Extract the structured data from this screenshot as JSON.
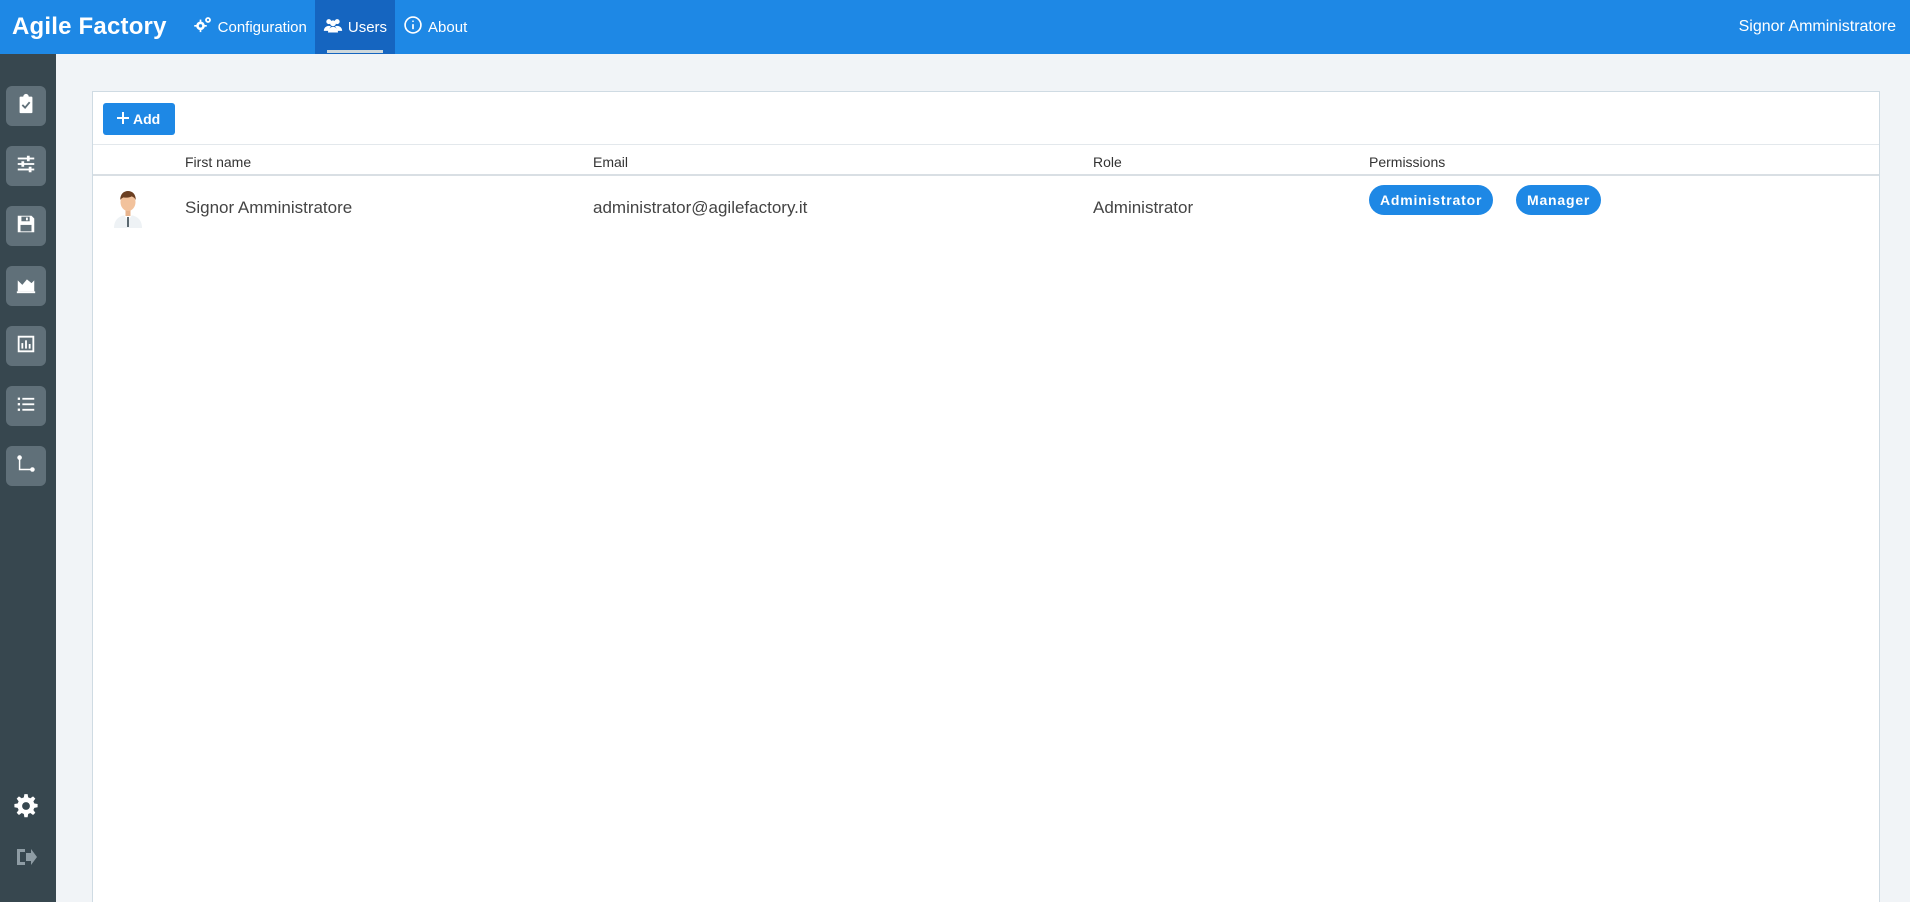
{
  "header": {
    "brand": "Agile Factory",
    "nav": [
      {
        "label": "Configuration",
        "icon": "cogs-icon"
      },
      {
        "label": "Users",
        "icon": "users-icon"
      },
      {
        "label": "About",
        "icon": "info-circle-icon"
      }
    ],
    "user_name": "Signor Amministratore"
  },
  "sidebar": {
    "items": [
      {
        "icon": "clipboard-check-icon"
      },
      {
        "icon": "sliders-icon"
      },
      {
        "icon": "save-icon"
      },
      {
        "icon": "area-chart-icon"
      },
      {
        "icon": "bar-chart-icon"
      },
      {
        "icon": "list-icon"
      },
      {
        "icon": "workflow-icon"
      }
    ],
    "bottom": [
      {
        "icon": "gear-icon"
      },
      {
        "icon": "logout-icon"
      }
    ]
  },
  "toolbar": {
    "add_label": "Add"
  },
  "table": {
    "columns": [
      "First name",
      "Email",
      "Role",
      "Permissions"
    ],
    "rows": [
      {
        "first_name": "Signor Amministratore",
        "email": "administrator@agilefactory.it",
        "role": "Administrator",
        "permissions": [
          "Administrator",
          "Manager"
        ]
      }
    ]
  },
  "colors": {
    "primary": "#1e88e5",
    "sidebar": "#37474f",
    "background": "#f1f4f7"
  }
}
